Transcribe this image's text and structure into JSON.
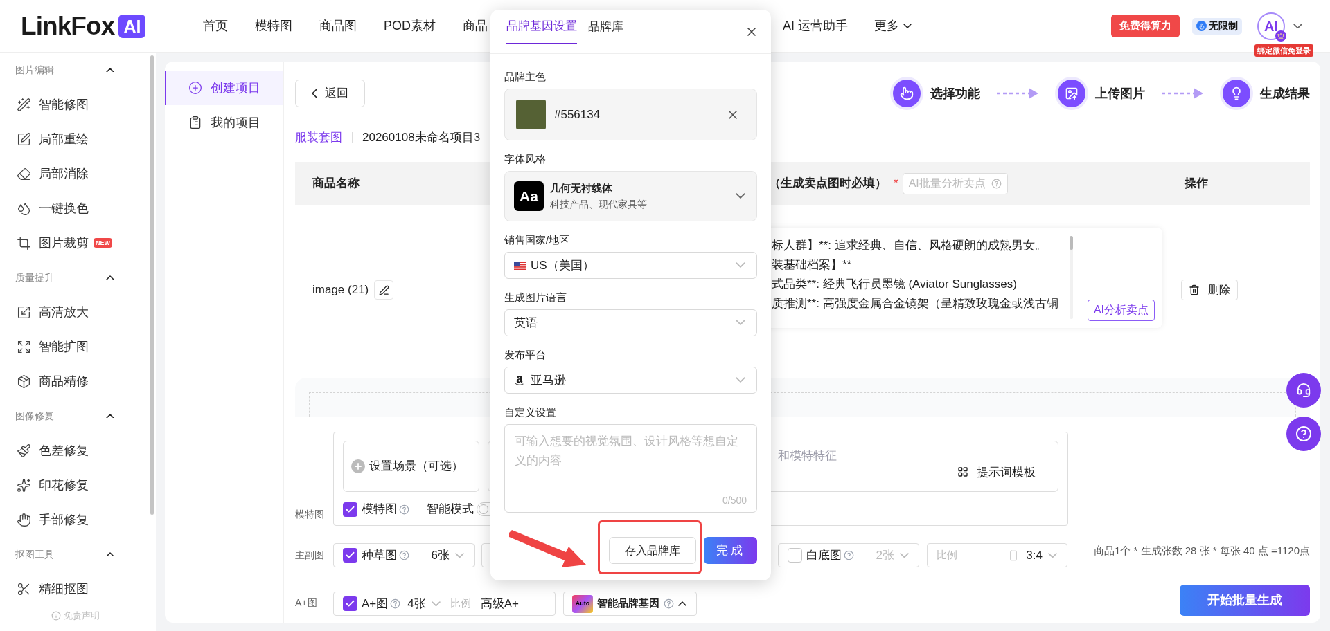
{
  "logo": {
    "name": "LinkFox",
    "badge": "AI"
  },
  "nav": [
    {
      "label": "首页"
    },
    {
      "label": "模特图"
    },
    {
      "label": "商品图"
    },
    {
      "label": "POD素材"
    },
    {
      "label": "商品"
    },
    {
      "label": "AI 运营助手"
    },
    {
      "label": "更多",
      "kind": "dropdown"
    }
  ],
  "account": {
    "credits_button": "免费得算力",
    "plan_badge": "无限制",
    "avatar": "AI",
    "avatar_tag": "绑定微信免登录"
  },
  "sidebar": {
    "groups": [
      {
        "title": "图片编辑",
        "expanded": true,
        "items": [
          {
            "label": "智能修图"
          },
          {
            "label": "局部重绘"
          },
          {
            "label": "局部消除"
          },
          {
            "label": "一键换色"
          },
          {
            "label": "图片裁剪",
            "badge": "NEW"
          }
        ]
      },
      {
        "title": "质量提升",
        "expanded": true,
        "items": [
          {
            "label": "高清放大"
          },
          {
            "label": "智能扩图"
          },
          {
            "label": "商品精修"
          }
        ]
      },
      {
        "title": "图像修复",
        "expanded": true,
        "items": [
          {
            "label": "色差修复"
          },
          {
            "label": "印花修复"
          },
          {
            "label": "手部修复"
          }
        ]
      },
      {
        "title": "抠图工具",
        "expanded": true,
        "items": [
          {
            "label": "精细抠图"
          }
        ]
      }
    ],
    "footer": "免责声明"
  },
  "project_nav": [
    {
      "label": "创建项目",
      "selected": true
    },
    {
      "label": "我的项目",
      "selected": false
    }
  ],
  "back_button": "返回",
  "steps": [
    {
      "label": "选择功能"
    },
    {
      "label": "上传图片"
    },
    {
      "label": "生成结果"
    }
  ],
  "breadcrumb": {
    "category": "服装套图",
    "project": "20260108未命名项目3"
  },
  "table": {
    "columns": [
      {
        "label": "商品名称"
      },
      {
        "label": "（生成卖点图时必填）",
        "required_mark": "*",
        "action": "AI批量分析卖点"
      },
      {
        "label": "操作"
      }
    ],
    "rows": [
      {
        "name": "image (21)",
        "selling_points": [
          "标人群】**: 追求经典、自信、风格硬朗的成熟男女。",
          "装基础档案】**",
          "式品类**: 经典飞行员墨镜 (Aviator Sunglasses)",
          "质推测**: 高强度金属合金镜架（呈精致玫瑰金或浅古铜"
        ],
        "analyze_button": "AI分析卖点",
        "delete_button": "删除"
      }
    ]
  },
  "settings": {
    "scene_button": "设置场景（可选）",
    "prompt_placeholder": "和模特特征",
    "template_button": "提示词模板",
    "model_row": {
      "label": "模特图",
      "option": {
        "label": "模特图",
        "checked": true
      },
      "smart_mode": "智能模式",
      "smart_mode_on": false
    },
    "main_row": {
      "label": "主副图",
      "options": [
        {
          "label": "种草图",
          "checked": true,
          "count": "6张"
        },
        {
          "label": "白底图",
          "checked": false,
          "count": "2张"
        }
      ],
      "ratio": {
        "label": "比例",
        "value": "3:4"
      }
    },
    "aplus_row": {
      "label": "A+图",
      "option": {
        "label": "A+图",
        "checked": true,
        "count": "4张",
        "ratio_label": "比例",
        "ratio_value": "高级A+"
      },
      "brand_gene": {
        "icon": "Auto",
        "label": "智能品牌基因",
        "expanded": true
      }
    },
    "cost": "商品1个 * 生成张数 28 张 * 每张 40 点 =1120点",
    "generate_button": "开始批量生成"
  },
  "dialog": {
    "tabs": [
      {
        "label": "品牌基因设置",
        "selected": true
      },
      {
        "label": "品牌库",
        "selected": false
      }
    ],
    "brand_color": {
      "label": "品牌主色",
      "value": "#556134",
      "color": "#556134"
    },
    "font_style": {
      "label": "字体风格",
      "sample": "Aa",
      "name": "几何无衬线体",
      "description": "科技产品、现代家具等"
    },
    "country": {
      "label": "销售国家/地区",
      "value": "US（美国）"
    },
    "language": {
      "label": "生成图片语言",
      "value": "英语"
    },
    "platform": {
      "label": "发布平台",
      "value": "亚马逊"
    },
    "custom": {
      "label": "自定义设置",
      "placeholder": "可输入想要的视觉氛围、设计风格等想自定义的内容",
      "counter": "0/500"
    },
    "buttons": {
      "save": "存入品牌库",
      "done": "完成"
    }
  }
}
